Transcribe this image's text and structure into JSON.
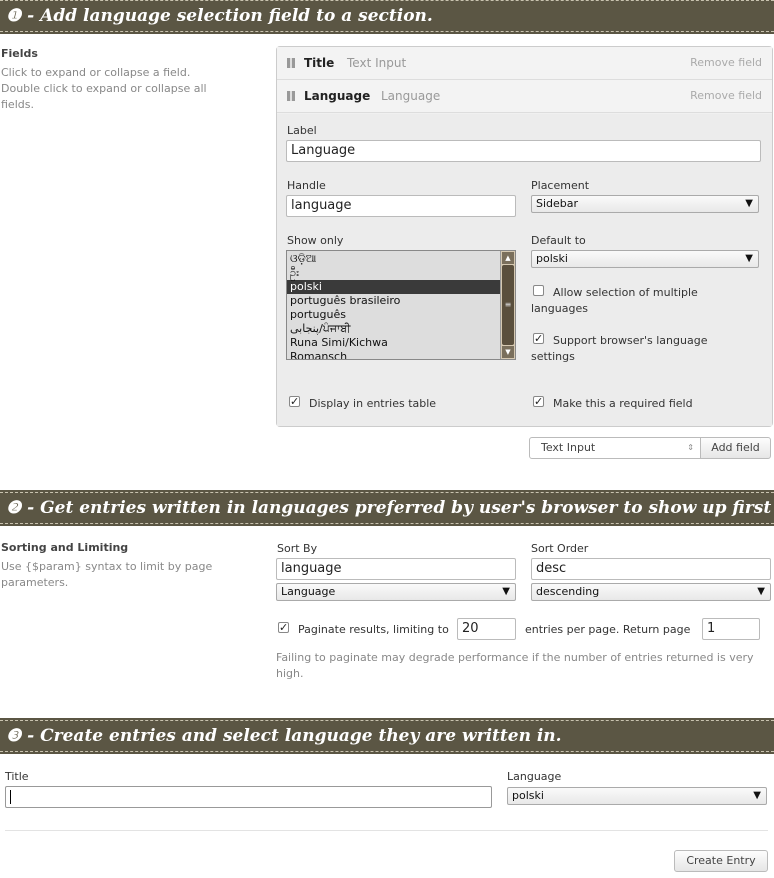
{
  "banners": {
    "step1": "❶ - Add language selection field to a section.",
    "step2": "❷ - Get entries written in languages preferred by user's browser to show up first from data-source.",
    "step3": "❸ - Create entries and select language they are written in."
  },
  "fields_section": {
    "title": "Fields",
    "help": "Click to expand or collapse a field. Double click to expand or collapse all fields.",
    "rows": [
      {
        "name": "Title",
        "type": "Text Input",
        "remove": "Remove field"
      },
      {
        "name": "Language",
        "type": "Language",
        "remove": "Remove field"
      }
    ],
    "label_label": "Label",
    "label_value": "Language",
    "handle_label": "Handle",
    "handle_value": "language",
    "placement_label": "Placement",
    "placement_value": "Sidebar",
    "show_only_label": "Show only",
    "show_only_options": [
      "ଓଡ଼ିଆ",
      "ဦး",
      "polski",
      "português brasileiro",
      "português",
      "پنجابی/ਪੰਜਾਬੀ",
      "Runa Simi/Kichwa",
      "Romansch"
    ],
    "show_only_selected": "polski",
    "default_to_label": "Default to",
    "default_to_value": "polski",
    "allow_multiple_label": "Allow selection of multiple languages",
    "allow_multiple_checked": false,
    "browser_language_label": "Support browser's language settings",
    "browser_language_checked": true,
    "display_in_table_label": "Display in entries table",
    "display_in_table_checked": true,
    "required_label": "Make this a required field",
    "required_checked": true,
    "new_field_type": "Text Input",
    "add_field_button": "Add field"
  },
  "sorting_section": {
    "title": "Sorting and Limiting",
    "help": "Use {$param} syntax to limit by page parameters.",
    "sort_by_label": "Sort By",
    "sort_by_value": "language",
    "sort_by_select": "Language",
    "sort_order_label": "Sort Order",
    "sort_order_value": "desc",
    "sort_order_select": "descending",
    "paginate_label": "Paginate results, limiting to",
    "paginate_checked": true,
    "limit_value": "20",
    "per_page_label": "entries per page. Return page",
    "page_value": "1",
    "paginate_note": "Failing to paginate may degrade performance if the number of entries returned is very high."
  },
  "entry_section": {
    "title_label": "Title",
    "title_value": "",
    "language_label": "Language",
    "language_value": "polski",
    "create_button": "Create Entry"
  },
  "colors": {
    "banner_bg": "#5b5644",
    "selected_option_bg": "#3a3a3a"
  }
}
